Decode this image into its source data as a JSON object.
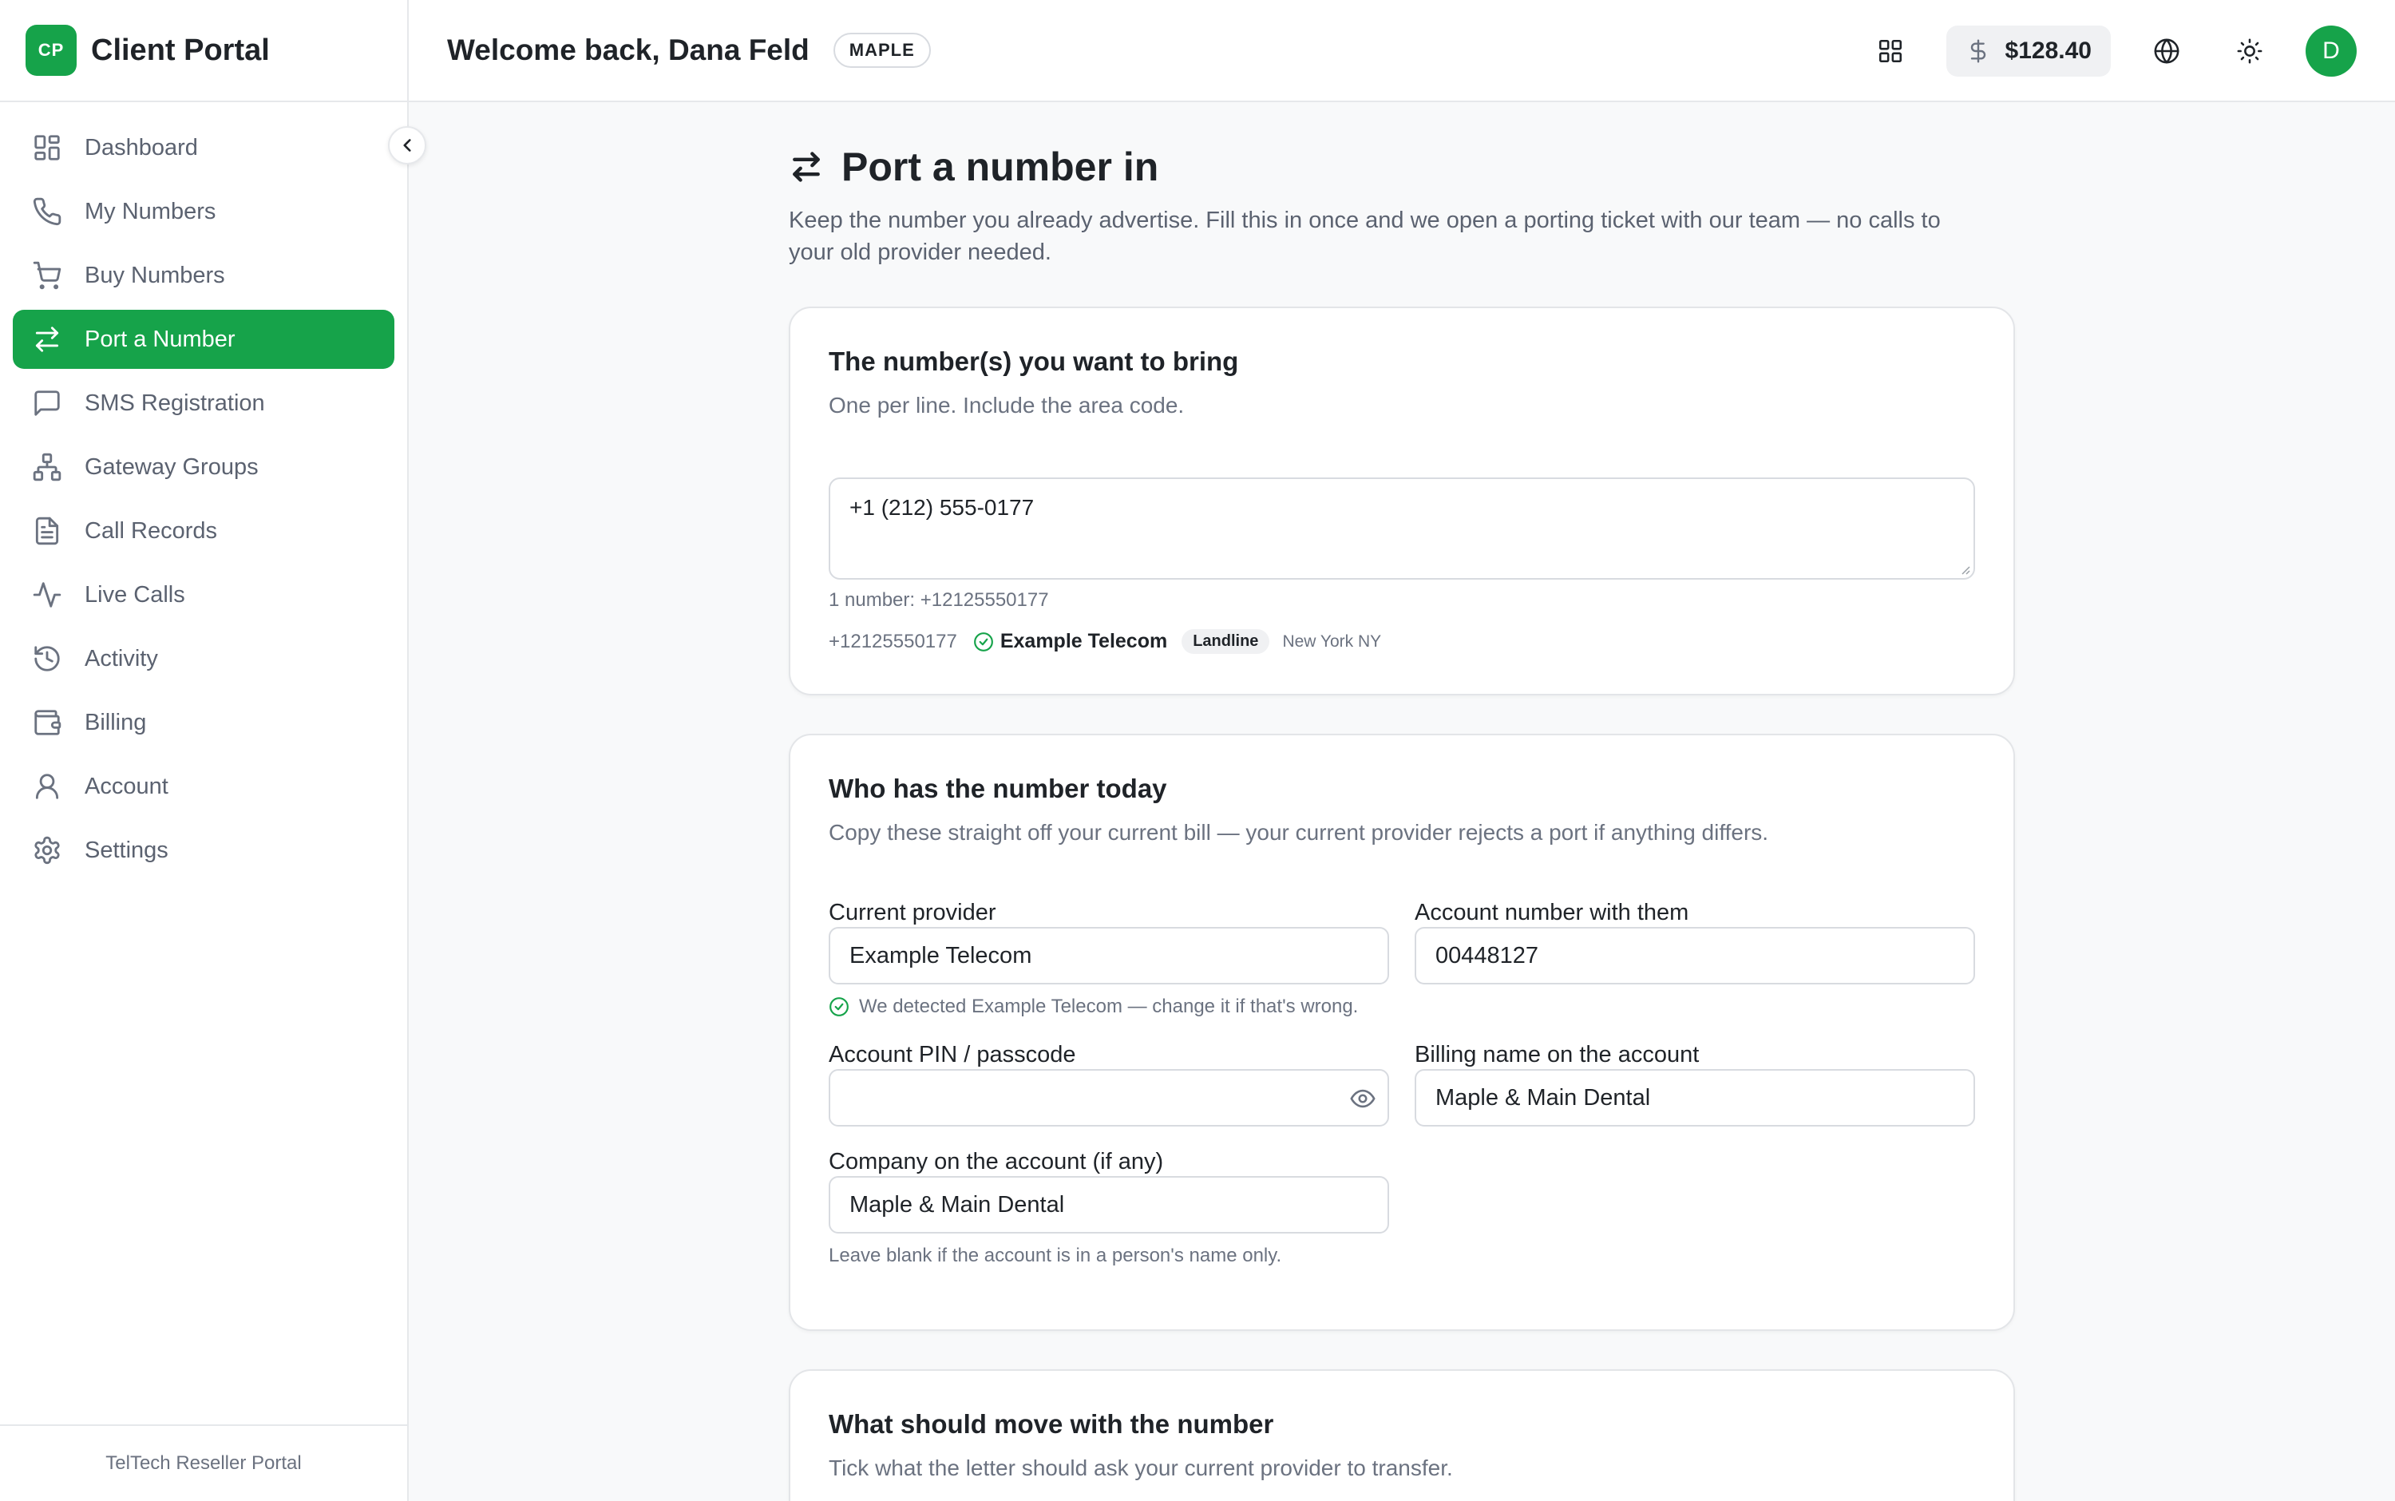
{
  "brand": {
    "logo_text": "CP",
    "name": "Client Portal"
  },
  "sidebar": {
    "items": [
      {
        "label": "Dashboard",
        "icon": "dashboard-icon"
      },
      {
        "label": "My Numbers",
        "icon": "phone-icon"
      },
      {
        "label": "Buy Numbers",
        "icon": "cart-icon"
      },
      {
        "label": "Port a Number",
        "icon": "swap-arrows-icon",
        "active": true
      },
      {
        "label": "SMS Registration",
        "icon": "message-icon"
      },
      {
        "label": "Gateway Groups",
        "icon": "network-icon"
      },
      {
        "label": "Call Records",
        "icon": "document-icon"
      },
      {
        "label": "Live Calls",
        "icon": "activity-wave-icon"
      },
      {
        "label": "Activity",
        "icon": "history-icon"
      },
      {
        "label": "Billing",
        "icon": "wallet-icon"
      },
      {
        "label": "Account",
        "icon": "user-icon"
      },
      {
        "label": "Settings",
        "icon": "gear-icon"
      }
    ],
    "footer": "TelTech Reseller Portal"
  },
  "header": {
    "welcome": "Welcome back, Dana Feld",
    "tenant_badge": "MAPLE",
    "balance": "$128.40",
    "avatar_initial": "D"
  },
  "page": {
    "title": "Port a number in",
    "subtitle": "Keep the number you already advertise. Fill this in once and we open a porting ticket with our team — no calls to your old provider needed."
  },
  "numbers_card": {
    "title": "The number(s) you want to bring",
    "desc": "One per line. Include the area code.",
    "textarea_value": "+1 (212) 555-0177",
    "count_hint": "1 number: +12125550177",
    "detected": {
      "number": "+12125550177",
      "carrier": "Example Telecom",
      "line_type": "Landline",
      "location": "New York NY"
    }
  },
  "owner_card": {
    "title": "Who has the number today",
    "desc": "Copy these straight off your current bill — your current provider rejects a port if anything differs.",
    "current_provider": {
      "label": "Current provider",
      "value": "Example Telecom",
      "help": "We detected Example Telecom — change it if that's wrong."
    },
    "account_number": {
      "label": "Account number with them",
      "value": "00448127"
    },
    "pin": {
      "label": "Account PIN / passcode",
      "value": ""
    },
    "billing_name": {
      "label": "Billing name on the account",
      "value": "Maple & Main Dental"
    },
    "company": {
      "label": "Company on the account (if any)",
      "value": "Maple & Main Dental",
      "help": "Leave blank if the account is in a person's name only."
    }
  },
  "move_card": {
    "title": "What should move with the number",
    "desc": "Tick what the letter should ask your current provider to transfer."
  },
  "colors": {
    "accent": "#16a34a",
    "border": "#e6e8eb",
    "muted": "#6b7280"
  }
}
